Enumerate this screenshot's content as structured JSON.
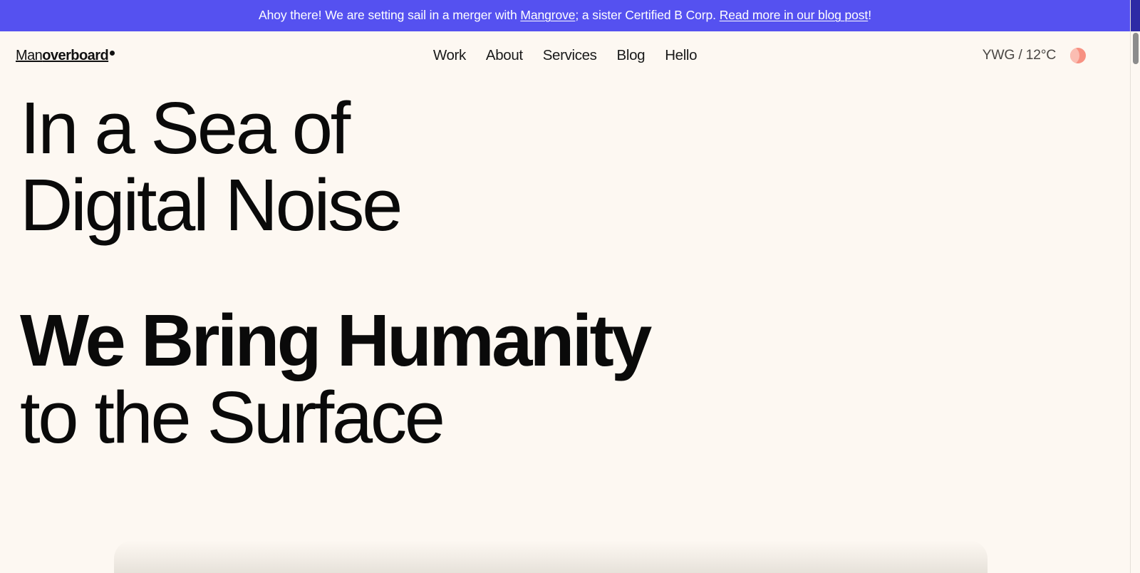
{
  "theme": {
    "background": "#FDF8F2",
    "banner_background": "#5551F0",
    "text_color": "#0A0A0A",
    "weather_orb_color": "#F79182",
    "scrollbar_thumb": "#8C8C8C"
  },
  "banner": {
    "text_before_first_link": "Ahoy there! We are setting sail in a merger with ",
    "first_link": "Mangrove",
    "text_between_links": "; a sister Certified B Corp. ",
    "second_link": "Read more in our blog post",
    "text_after_last_link": "!"
  },
  "header": {
    "logo": {
      "light_part": "Man",
      "bold_part": "overboard",
      "dot": "●"
    },
    "nav": [
      {
        "label": "Work"
      },
      {
        "label": "About"
      },
      {
        "label": "Services"
      },
      {
        "label": "Blog"
      },
      {
        "label": "Hello"
      }
    ],
    "utility": {
      "weather": "YWG / 12°C",
      "weather_icon_name": "weather-orb-icon"
    }
  },
  "hero": {
    "headline_primary": {
      "line1": "In a Sea of",
      "line2": "Digital Noise"
    },
    "headline_secondary": {
      "line1": "We Bring Humanity",
      "line2": "to the Surface"
    }
  }
}
